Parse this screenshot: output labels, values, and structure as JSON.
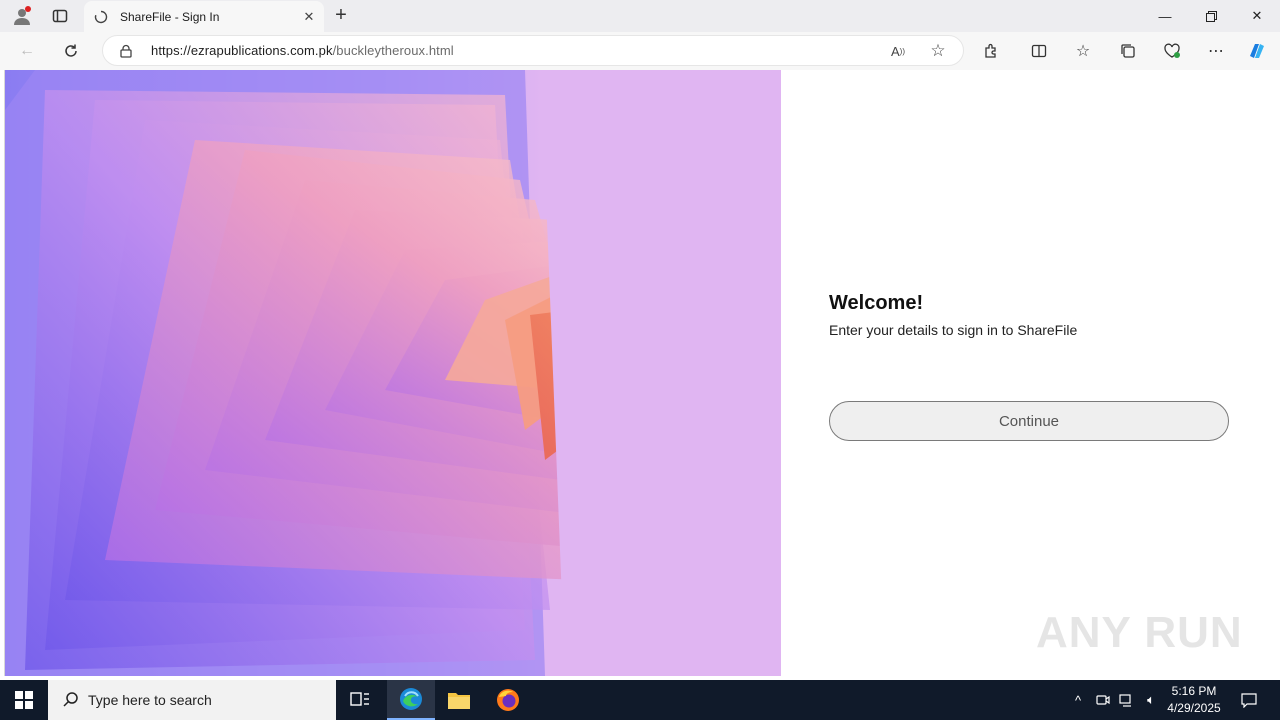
{
  "browser": {
    "tab_title": "ShareFile - Sign In",
    "url_host": "https://ezrapublications.com.pk",
    "url_path": "/buckleytheroux.html"
  },
  "page": {
    "heading": "Welcome!",
    "subtitle": "Enter your details to sign in to ShareFile",
    "continue_label": "Continue",
    "watermark": "ANY RUN"
  },
  "taskbar": {
    "search_placeholder": "Type here to search",
    "time": "5:16 PM",
    "date": "4/29/2025"
  },
  "icons": {
    "hero_colors": [
      "#e0b5f2",
      "#7b63f0",
      "#b58af0",
      "#f2a7c4",
      "#f39466"
    ]
  }
}
